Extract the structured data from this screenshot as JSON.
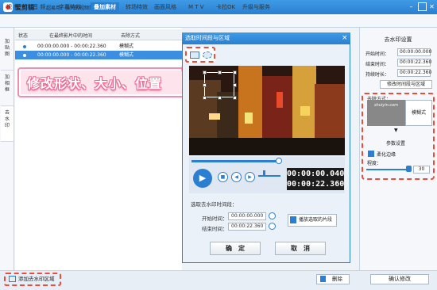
{
  "app": {
    "name": "爱剪辑",
    "tagline": "超易用、强大的视频剪辑软件"
  },
  "menu": [
    "视 频",
    "音 频",
    "字幕特效",
    "叠加素材",
    "转场特效",
    "画面风格",
    "M T V",
    "卡拉OK",
    "升级与服务"
  ],
  "menu_active_index": 3,
  "left_tabs": [
    "加贴图",
    "加相框",
    "去水印"
  ],
  "table": {
    "headers": [
      "状态",
      "在最终影片中的时间",
      "去除方式"
    ],
    "rows": [
      {
        "time": "00:00:00.000 - 00:00:22.360",
        "method": "模糊式",
        "selected": false
      },
      {
        "time": "00:00:00.000 - 00:00:22.360",
        "method": "模糊式",
        "selected": true
      }
    ]
  },
  "callout": {
    "text": "修改形状、大小、位置"
  },
  "dialog": {
    "title": "选取时间段与区域",
    "close": "×",
    "current_time": "00:00:00.040",
    "total_time": "00:00:22.360",
    "period_label": "选取去水印时间段：",
    "start_label": "开始时间：",
    "start_value": "00:00:00.000",
    "end_label": "结束时间：",
    "end_value": "00:00:22.360",
    "play_button": "播放选取的片段",
    "ok": "确　定",
    "cancel": "取　消"
  },
  "right_panel": {
    "title": "去水印设置",
    "start_label": "开始时间：",
    "start_value": "00:00:00.000",
    "end_label": "结束时间：",
    "end_value": "00:00:22.360",
    "duration_label": "持续时长：",
    "duration_value": "00:00:22.360",
    "modify_button": "修改时间段与区域",
    "method_label": "去除方式：",
    "method_value": "模糊式",
    "thumb_text": "shuiyin.com",
    "params_label": "参数设置",
    "soften_label": "柔化边缘",
    "strength_label": "程度：",
    "strength_value": "30"
  },
  "bottom": {
    "add": "添加去水印区域",
    "delete": "删除",
    "confirm": "确认修改"
  },
  "colors": {
    "accent": "#2a7fd0",
    "highlight": "#e94b3c",
    "callout": "#f28cae"
  }
}
